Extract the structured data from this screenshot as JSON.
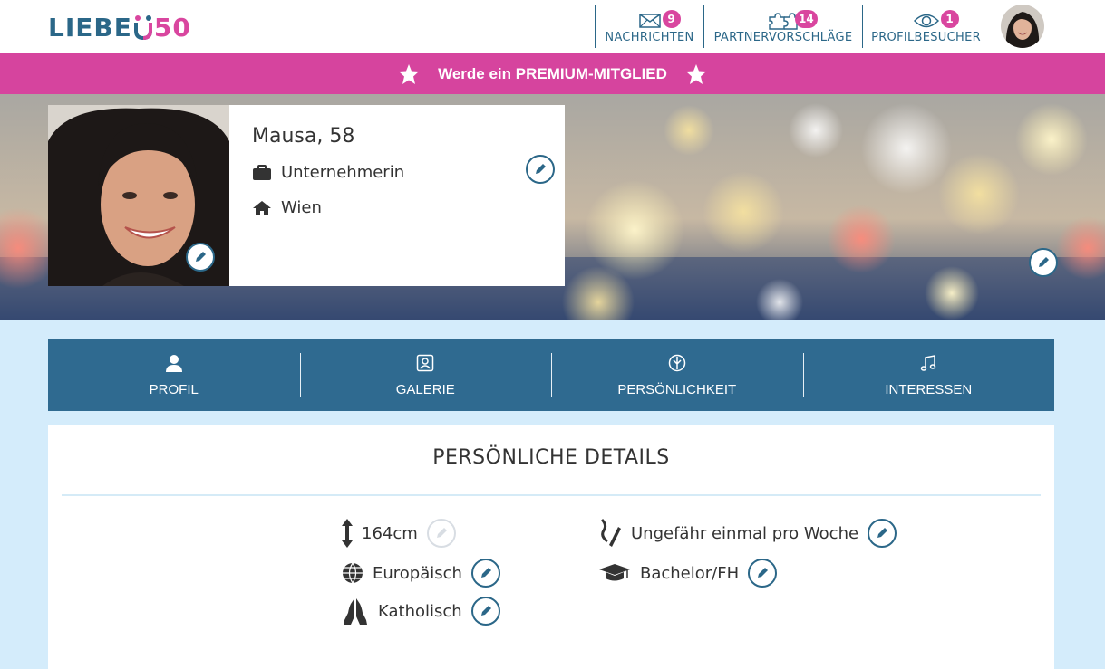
{
  "header": {
    "logo_left": "LIEBE",
    "logo_right": "50",
    "nav": [
      {
        "label": "NACHRICHTEN",
        "count": "9",
        "icon": "envelope-icon"
      },
      {
        "label": "PARTNERVORSCHLÄGE",
        "count": "14",
        "icon": "puzzle-icon"
      },
      {
        "label": "PROFILBESUCHER",
        "count": "1",
        "icon": "eye-icon"
      }
    ]
  },
  "banner": {
    "text": "Werde ein PREMIUM-MITGLIED"
  },
  "profile": {
    "name_age": "Mausa, 58",
    "job": "Unternehmerin",
    "city": "Wien"
  },
  "tabs": [
    {
      "label": "PROFIL",
      "icon": "person-icon"
    },
    {
      "label": "GALERIE",
      "icon": "portrait-icon"
    },
    {
      "label": "PERSÖNLICHKEIT",
      "icon": "personality-icon"
    },
    {
      "label": "INTERESSEN",
      "icon": "music-icon"
    }
  ],
  "details": {
    "title": "PERSÖNLICHE DETAILS",
    "height": "164cm",
    "ethnicity": "Europäisch",
    "religion": "Katholisch",
    "smoking": "Ungefähr einmal pro Woche",
    "education": "Bachelor/FH"
  },
  "colors": {
    "brand_blue": "#2b6788",
    "brand_pink": "#d6449e",
    "tab_bar": "#2f6a90",
    "page_bg": "#d4ecfb"
  }
}
